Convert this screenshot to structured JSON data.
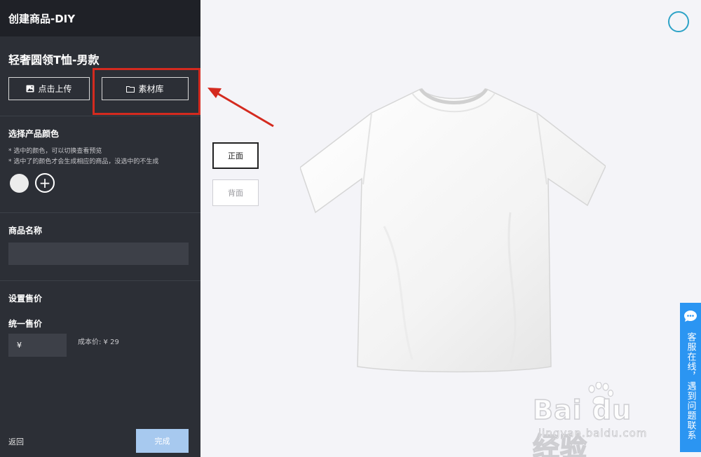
{
  "header": {
    "title": "创建商品-DIY"
  },
  "product": {
    "title": "轻奢圆领T恤-男款"
  },
  "actions": {
    "upload_label": "点击上传",
    "library_label": "素材库"
  },
  "color_section": {
    "title": "选择产品颜色",
    "notes": [
      "* 选中的颜色，可以切换查看预览",
      "* 选中了的颜色才会生成相应的商品，没选中的不生成"
    ],
    "add_symbol": "+"
  },
  "name_section": {
    "title": "商品名称",
    "value": ""
  },
  "price_section": {
    "title": "设置售价",
    "unified_label": "统一售价",
    "currency": "¥",
    "cost_label": "成本价: ¥ 29"
  },
  "footer": {
    "back_label": "返回",
    "done_label": "完成"
  },
  "sides": {
    "front_label": "正面",
    "back_label": "背面"
  },
  "support": {
    "text": "客服在线，遇到问题联系"
  },
  "watermark": {
    "main": "Bai du 经验",
    "sub": "jingyan.baidu.com"
  },
  "colors": {
    "sidebar": "#2c2f36",
    "header": "#1f2127",
    "accent": "#2b95f2",
    "highlight": "#d42a1f",
    "done": "#a7c9ef"
  }
}
